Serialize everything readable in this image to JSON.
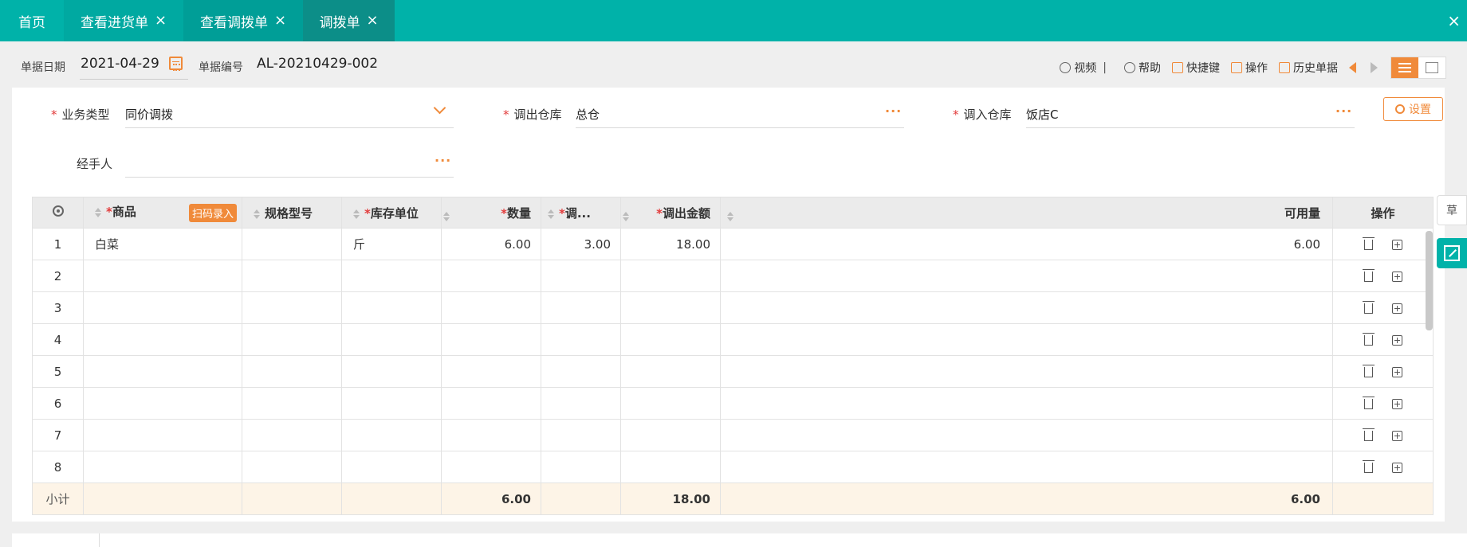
{
  "tabs": [
    {
      "label": "首页",
      "closable": false
    },
    {
      "label": "查看进货单",
      "closable": true
    },
    {
      "label": "查看调拨单",
      "closable": true
    },
    {
      "label": "调拨单",
      "closable": true,
      "active": true
    }
  ],
  "close_symbol": "×",
  "header": {
    "date_label": "单据日期",
    "date_value": "2021-04-29",
    "number_label": "单据编号",
    "number_value": "AL-20210429-002"
  },
  "toolbar": {
    "video": "视频",
    "divider": "|",
    "help": "帮助",
    "shortcut": "快捷键",
    "operate": "操作",
    "history": "历史单据"
  },
  "form": {
    "biz_type_label": "业务类型",
    "biz_type_value": "同价调拨",
    "out_wh_label": "调出仓库",
    "out_wh_value": "总仓",
    "in_wh_label": "调入仓库",
    "in_wh_value": "饭店C",
    "handler_label": "经手人",
    "handler_value": "",
    "settings_label": "设置",
    "required_mark": "*",
    "more": "···"
  },
  "table": {
    "headers": {
      "product": "商品",
      "scan": "扫码录入",
      "spec": "规格型号",
      "unit": "库存单位",
      "qty": "数量",
      "price": "调...",
      "amount": "调出金额",
      "available": "可用量",
      "actions": "操作"
    },
    "rows": [
      {
        "no": "1",
        "product": "白菜",
        "spec": "",
        "unit": "斤",
        "qty": "6.00",
        "price": "3.00",
        "amount": "18.00",
        "available": "6.00"
      },
      {
        "no": "2",
        "product": "",
        "spec": "",
        "unit": "",
        "qty": "",
        "price": "",
        "amount": "",
        "available": ""
      },
      {
        "no": "3",
        "product": "",
        "spec": "",
        "unit": "",
        "qty": "",
        "price": "",
        "amount": "",
        "available": ""
      },
      {
        "no": "4",
        "product": "",
        "spec": "",
        "unit": "",
        "qty": "",
        "price": "",
        "amount": "",
        "available": ""
      },
      {
        "no": "5",
        "product": "",
        "spec": "",
        "unit": "",
        "qty": "",
        "price": "",
        "amount": "",
        "available": ""
      },
      {
        "no": "6",
        "product": "",
        "spec": "",
        "unit": "",
        "qty": "",
        "price": "",
        "amount": "",
        "available": ""
      },
      {
        "no": "7",
        "product": "",
        "spec": "",
        "unit": "",
        "qty": "",
        "price": "",
        "amount": "",
        "available": ""
      },
      {
        "no": "8",
        "product": "",
        "spec": "",
        "unit": "",
        "qty": "",
        "price": "",
        "amount": "",
        "available": ""
      }
    ],
    "subtotal": {
      "label": "小计",
      "qty": "6.00",
      "amount": "18.00",
      "available": "6.00"
    }
  },
  "side": {
    "draft": "草"
  },
  "colors": {
    "primary": "#00b2a9",
    "accent": "#f08a3a",
    "required": "#e23a3a",
    "subtotal_bg": "#fdf4e7"
  }
}
